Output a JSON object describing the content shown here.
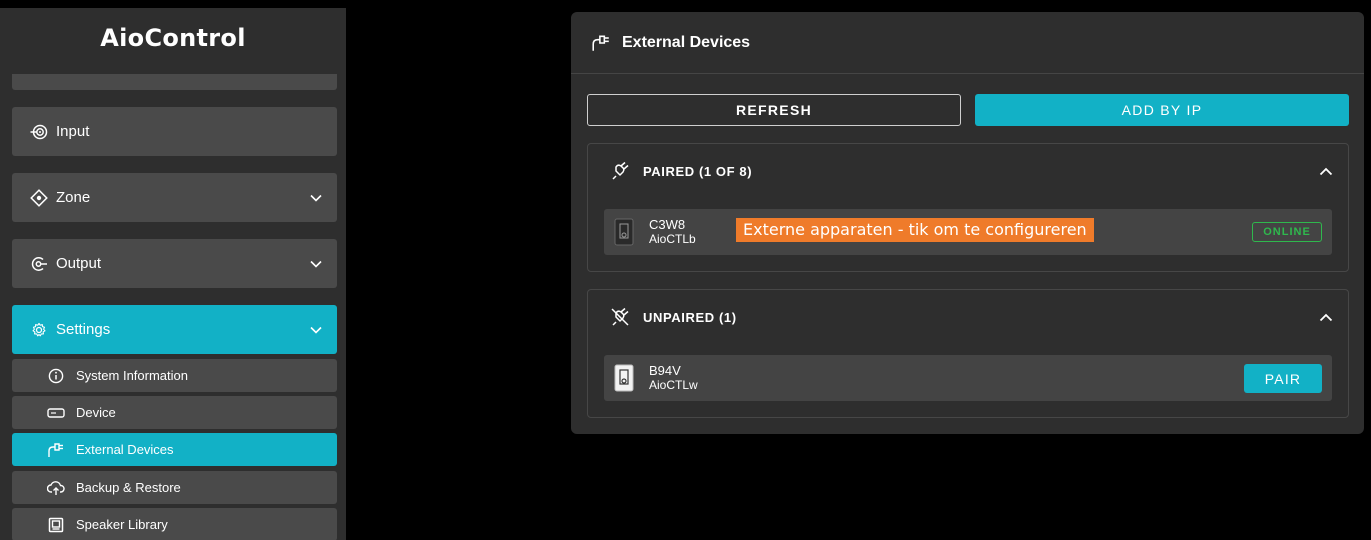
{
  "app": {
    "brand": "AioControl"
  },
  "sidebar": {
    "items": [
      {
        "label": "Input",
        "icon": "input-icon"
      },
      {
        "label": "Zone",
        "icon": "zone-icon"
      },
      {
        "label": "Output",
        "icon": "output-icon"
      },
      {
        "label": "Settings",
        "icon": "settings-gear-icon"
      }
    ],
    "sub_items": [
      {
        "label": "System Information",
        "icon": "info-icon"
      },
      {
        "label": "Device",
        "icon": "device-icon"
      },
      {
        "label": "External Devices",
        "icon": "plug-icon"
      },
      {
        "label": "Backup & Restore",
        "icon": "cloud-upload-icon"
      },
      {
        "label": "Speaker Library",
        "icon": "speaker-library-icon"
      }
    ]
  },
  "panel": {
    "title": "External Devices",
    "refresh_label": "REFRESH",
    "add_label": "ADD BY IP",
    "paired": {
      "title": "PAIRED (1 OF 8)",
      "devices": [
        {
          "name": "C3W8",
          "model": "AioCTLb",
          "status": "ONLINE"
        }
      ],
      "tooltip": "Externe apparaten - tik om te configureren"
    },
    "unpaired": {
      "title": "UNPAIRED (1)",
      "devices": [
        {
          "name": "B94V",
          "model": "AioCTLw",
          "action": "PAIR"
        }
      ]
    }
  },
  "colors": {
    "accent": "#12b1c6",
    "online": "#2fb84d",
    "tooltip": "#ef7b2a"
  }
}
